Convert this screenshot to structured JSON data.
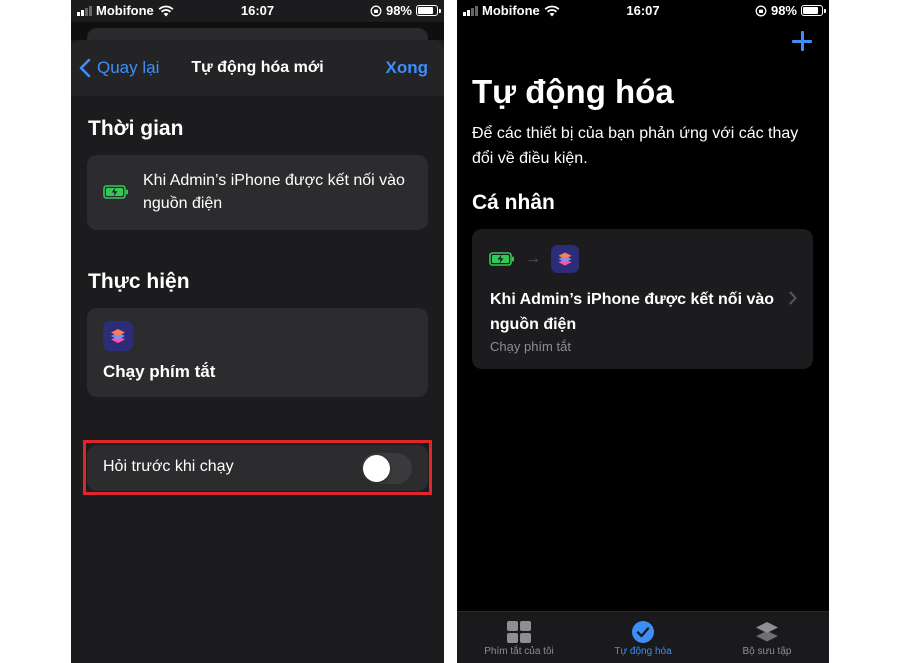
{
  "status_bar": {
    "carrier": "Mobifone",
    "time": "16:07",
    "battery_percent": "98%"
  },
  "left_screen": {
    "nav": {
      "back_label": "Quay lại",
      "title": "Tự động hóa mới",
      "done_label": "Xong"
    },
    "trigger_section": {
      "title": "Thời gian",
      "text": "Khi Admin’s iPhone được kết nối vào nguồn điện",
      "icon": "battery-charging-icon"
    },
    "action_section": {
      "title": "Thực hiện",
      "action_label": "Chạy phím tắt",
      "icon": "shortcuts-icon"
    },
    "ask_before_running": {
      "label": "Hỏi trước khi chạy",
      "enabled": false
    },
    "highlight_color": "#e0252b"
  },
  "right_screen": {
    "add_icon": "plus-icon",
    "title": "Tự động hóa",
    "subtitle": "Để các thiết bị của bạn phản ứng với các thay đổi về điều kiện.",
    "group_title": "Cá nhân",
    "automation": {
      "title": "Khi Admin’s iPhone được kết nối vào nguồn điện",
      "subtitle": "Chạy phím tắt"
    },
    "tabs": [
      {
        "label": "Phím tắt của tôi",
        "icon": "grid-icon",
        "active": false
      },
      {
        "label": "Tự động hóa",
        "icon": "clock-check-icon",
        "active": true
      },
      {
        "label": "Bộ sưu tập",
        "icon": "layers-icon",
        "active": false
      }
    ]
  },
  "colors": {
    "accent": "#3d8ef7",
    "battery_green": "#34c759"
  }
}
